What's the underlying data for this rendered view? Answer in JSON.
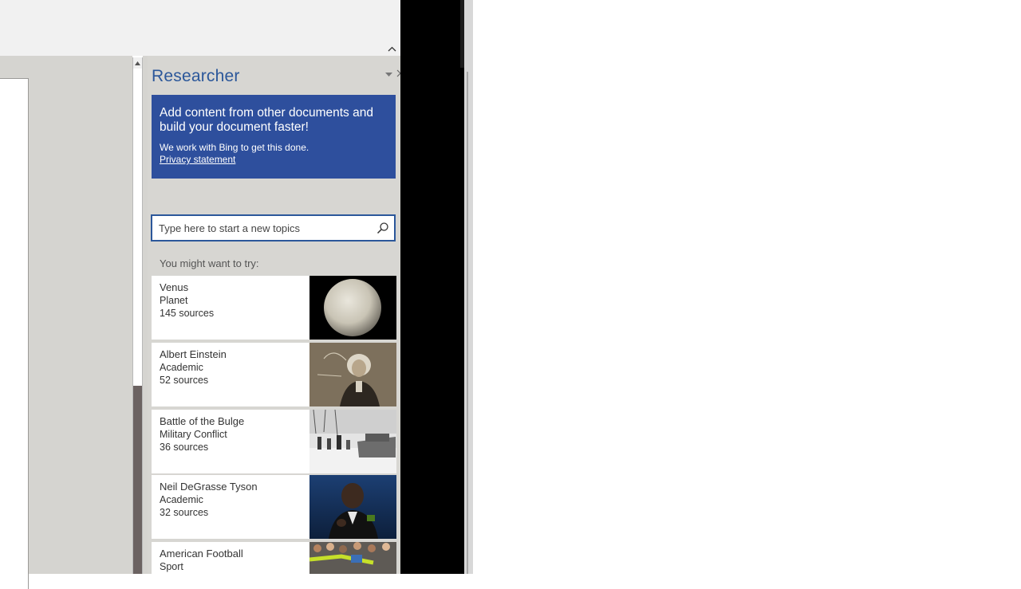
{
  "pane": {
    "title": "Researcher",
    "banner": {
      "heading": "Add content from other documents and build your document faster!",
      "body": "We work with Bing to get this done.",
      "link": "Privacy statement"
    },
    "search": {
      "placeholder": "Type here to start a new topics",
      "icon": "search-icon"
    },
    "suggest_label": "You might want to try:",
    "cards": [
      {
        "title": "Venus",
        "category": "Planet",
        "sources": "145 sources",
        "image": "venus-planet-image"
      },
      {
        "title": "Albert Einstein",
        "category": "Academic",
        "sources": "52 sources",
        "image": "einstein-portrait-image"
      },
      {
        "title": "Battle of the Bulge",
        "category": "Military Conflict",
        "sources": "36 sources",
        "image": "battle-photo-image"
      },
      {
        "title": "Neil DeGrasse Tyson",
        "category": "Academic",
        "sources": "32 sources",
        "image": "tyson-portrait-image"
      },
      {
        "title": "American Football",
        "category": "Sport",
        "sources": "",
        "image": "football-photo-image"
      }
    ]
  },
  "icons": {
    "collapse_ribbon": "chevron-up-icon",
    "pane_menu": "dropdown-triangle-icon",
    "scroll_up": "scroll-up-arrow-icon"
  },
  "colors": {
    "accent": "#2b579a",
    "banner": "#2e4f9d",
    "pane_bg": "#d7d6d2"
  }
}
